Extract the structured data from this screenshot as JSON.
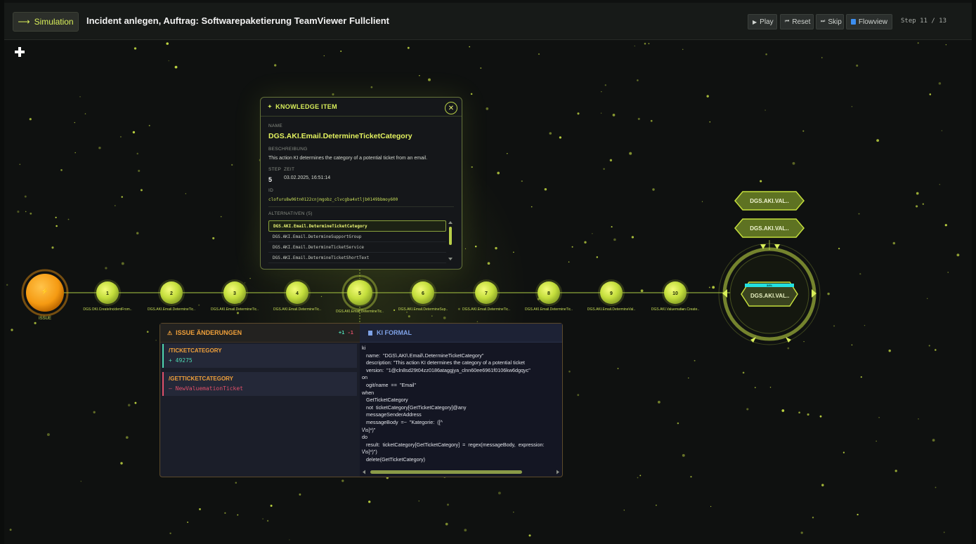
{
  "header": {
    "sim_button": "Simulation",
    "sim_arrow": "⟶",
    "title": "Incident anlegen, Auftrag: Softwarepaketierung TeamViewer Fullclient",
    "play": "Play",
    "reset": "Reset",
    "skip": "Skip",
    "flowview": "Flowview",
    "step": "Step 11 / 13"
  },
  "flow": {
    "issue_label": "ISSUE",
    "issue_glyph": "⚡",
    "nodes": [
      {
        "num": "1",
        "label": "DGS.OKI.CreateIncidentFrom.."
      },
      {
        "num": "2",
        "label": "DGS.AKI.Email.DetermineTic.."
      },
      {
        "num": "3",
        "label": "DGS.AKI.Email.DetermineTic.."
      },
      {
        "num": "4",
        "label": "DGS.AKI.Email.DetermineTic.."
      },
      {
        "num": "5",
        "label": "DGS.AKI.Email.DetermineTic.."
      },
      {
        "num": "6",
        "label": "DGS.AKI.Email.DetermineSup.."
      },
      {
        "num": "7",
        "label": "DGS.AKI.Email.DetermineTic.."
      },
      {
        "num": "8",
        "label": "DGS.AKI.Email.DetermineTic.."
      },
      {
        "num": "9",
        "label": "DGS.AKI.Email.DetermineVal.."
      },
      {
        "num": "10",
        "label": "DGS.AKI.Valuemation.Create.."
      }
    ],
    "current": {
      "label": "DGS.AKI.VAL..",
      "badge": "34%"
    },
    "upcoming": [
      "DGS.AKI.VAL..",
      "DGS.AKI.VAL.."
    ]
  },
  "knowledge": {
    "header": "KNOWLEDGE ITEM",
    "header_icon": "✦",
    "close": "✕",
    "name_label": "NAME",
    "name": "DGS.AKI.Email.DetermineTicketCategory",
    "desc_label": "BESCHREIBUNG",
    "desc": "This action KI determines the category of a potential ticket from an email.",
    "step_label": "STEP",
    "step": "5",
    "time_label": "ZEIT",
    "time": "03.02.2025, 16:51:14",
    "id_label": "ID",
    "id": "clofuru8w06tn0122cnjmgobz_clvcgba4xtljb0149bbmoy600",
    "alt_label": "ALTERNATIVEN (5)",
    "alternatives": [
      "DGS.AKI.Email.DetermineTicketCategory",
      "DGS.AKI.Email.DetermineSupportGroup",
      "DGS.AKI.Email.DetermineTicketService",
      "DGS.AKI.Email.DetermineTicketShortText"
    ]
  },
  "issue_changes": {
    "header": "ISSUE ÄNDERUNGEN",
    "header_icon": "⚠",
    "added": "+1",
    "removed": "-1",
    "items": [
      {
        "path": "/TICKETCATEGORY",
        "value": "+ 49275"
      },
      {
        "path": "/GETTICKETCATEGORY",
        "value": "– NewValuemationTicket"
      }
    ]
  },
  "ki_formal": {
    "header": "KI FORMAL",
    "lines": [
      "ki",
      "   name:  \"DGS\\.AKI\\.Email\\.DetermineTicketCategory\"",
      "   description: \"This action KI determines the category of a potential ticket",
      "   version:  \"1@cln8sd29t04zz0186ataggjya_clnn60ee6961f0106kw6dgqyc\"",
      "on",
      "   ogit/name  ==  \"Email\"",
      "when",
      "   GetTicketCategory",
      "   not  ticketCategory[GetTicketCategory]@any",
      "   messageSenderAddress",
      "   messageBody  =~  \"Kategorie:  ([^",
      "\\/\\s]*)\"",
      "do",
      "   result:  ticketCategory[GetTicketCategory]  =  regex(messageBody,  expression:",
      "\\/\\s]*)\")",
      "   delete(GetTicketCategory)"
    ]
  },
  "colors": {
    "accent": "#d9ef5a",
    "node": "#c4de3c",
    "issue": "#f59a12",
    "orange": "#f0a03a",
    "added": "#4fd6b0",
    "removed": "#e0506a",
    "cyan": "#22e0e0"
  }
}
